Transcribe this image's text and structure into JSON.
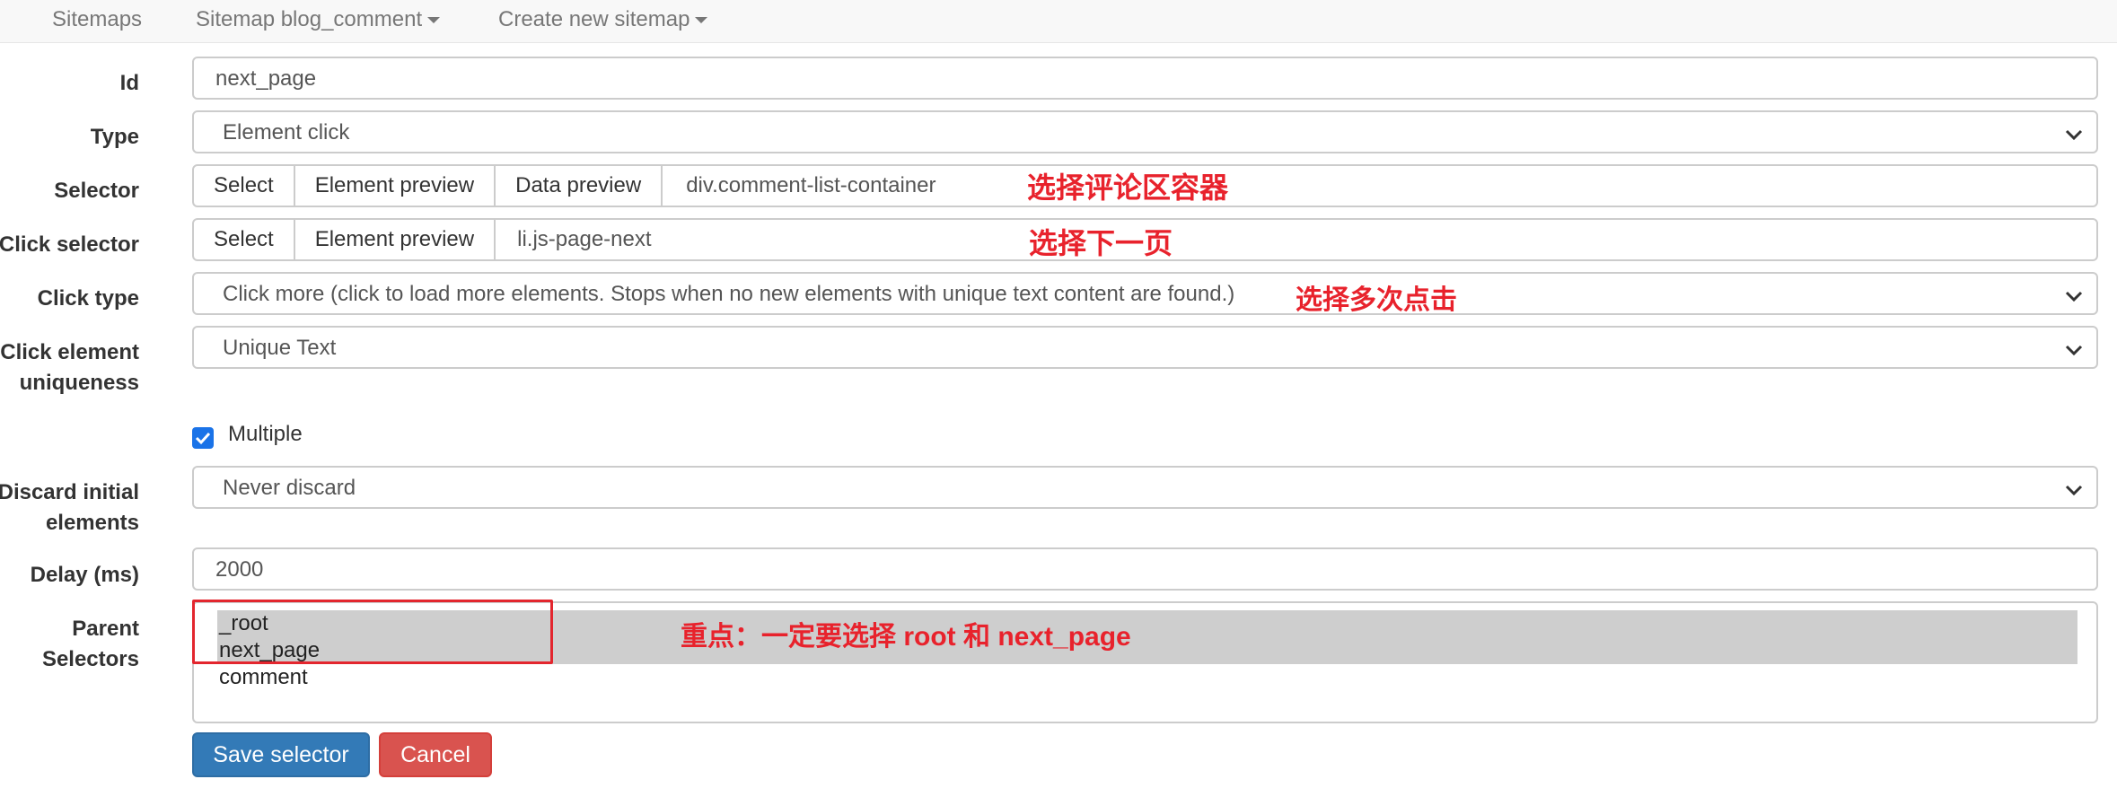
{
  "nav": {
    "sitemaps": "Sitemaps",
    "sitemap_menu": "Sitemap blog_comment",
    "create_menu": "Create new sitemap"
  },
  "form": {
    "id": {
      "label": "Id",
      "value": "next_page"
    },
    "type": {
      "label": "Type",
      "value": "Element click"
    },
    "selector": {
      "label": "Selector",
      "buttons": [
        "Select",
        "Element preview",
        "Data preview"
      ],
      "value": "div.comment-list-container",
      "annotation": "选择评论区容器"
    },
    "click_selector": {
      "label": "Click selector",
      "buttons": [
        "Select",
        "Element preview"
      ],
      "value": "li.js-page-next",
      "annotation": "选择下一页"
    },
    "click_type": {
      "label": "Click type",
      "value": "Click more (click to load more elements. Stops when no new elements with unique text content are found.)",
      "annotation": "选择多次点击"
    },
    "click_uniqueness": {
      "label_line1": "Click element",
      "label_line2": "uniqueness",
      "value": "Unique Text"
    },
    "multiple": {
      "label": "Multiple",
      "checked": true
    },
    "discard": {
      "label_line1": "Discard initial",
      "label_line2": "elements",
      "value": "Never discard"
    },
    "delay": {
      "label": "Delay (ms)",
      "value": "2000"
    },
    "parent_selectors": {
      "label_line1": "Parent",
      "label_line2": "Selectors",
      "options": [
        "_root",
        "next_page",
        "comment"
      ],
      "annotation": "重点：一定要选择 root 和 next_page"
    }
  },
  "actions": {
    "save": "Save selector",
    "cancel": "Cancel"
  },
  "colors": {
    "primary": "#337ab7",
    "danger": "#d9534f",
    "annotation": "#e8222c"
  }
}
